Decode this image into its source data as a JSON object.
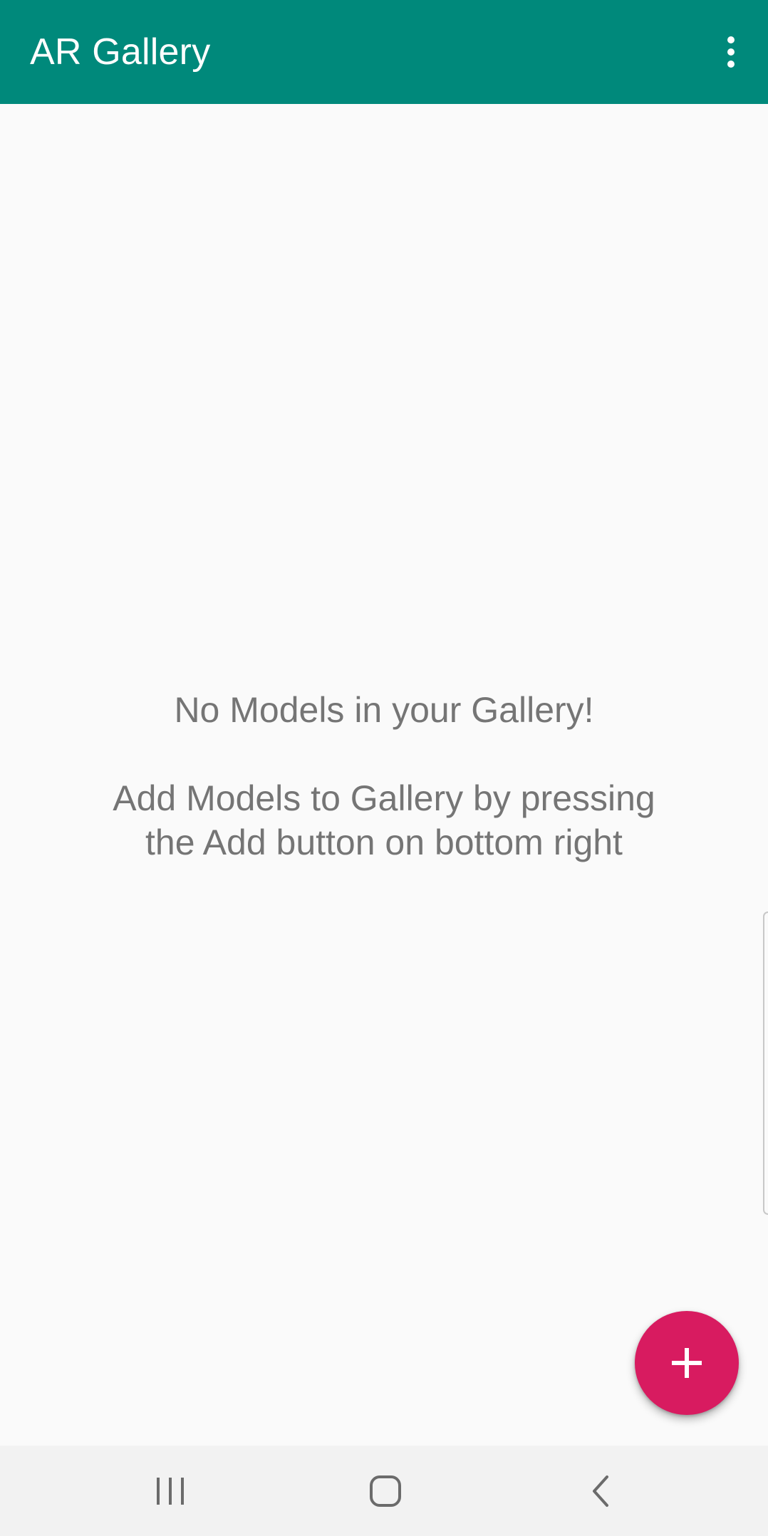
{
  "app_bar": {
    "title": "AR Gallery",
    "background_color": "#00897b",
    "overflow_icon": "more-vert-icon"
  },
  "empty_state": {
    "title": "No Models in your Gallery!",
    "hint_line1": "Add Models to Gallery by pressing",
    "hint_line2": "the Add button on bottom right",
    "text_color": "#757575"
  },
  "fab": {
    "icon": "plus-icon",
    "color": "#d81b60"
  },
  "nav_bar": {
    "recents_icon": "recents-icon",
    "home_icon": "home-icon",
    "back_icon": "back-icon"
  }
}
